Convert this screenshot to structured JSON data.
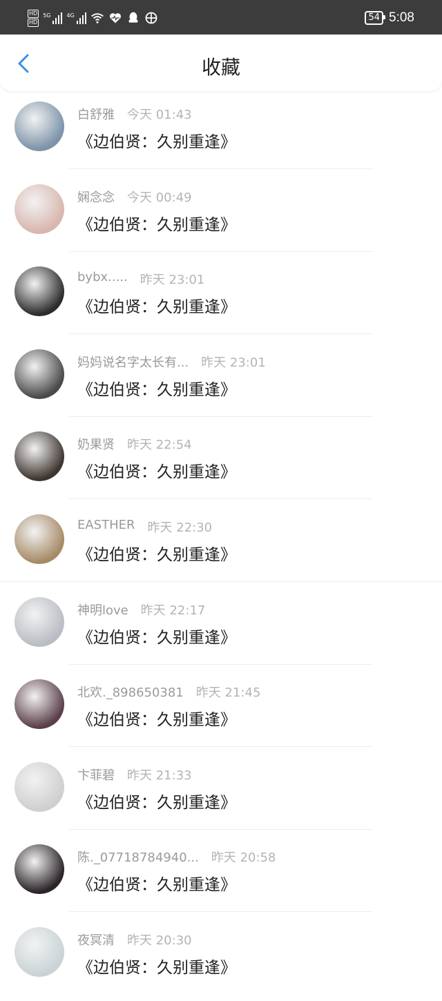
{
  "status_bar": {
    "hd1": "HD",
    "hd2": "HD",
    "sig1_label": "5G",
    "sig2_label": "4G",
    "wifi_label": "6",
    "battery": "54",
    "time": "5:08"
  },
  "header": {
    "title": "收藏"
  },
  "items": [
    {
      "name": "白舒雅",
      "time": "今天 01:43",
      "content": "《边伯贤：久别重逢》",
      "avatar_color": "#7c93a8"
    },
    {
      "name": "娴念念",
      "time": "今天 00:49",
      "content": "《边伯贤：久别重逢》",
      "avatar_color": "#d8b6ae"
    },
    {
      "name": "bybx.....",
      "time": "昨天 23:01",
      "content": "《边伯贤：久别重逢》",
      "avatar_color": "#2c2c2c"
    },
    {
      "name": "妈妈说名字太长有...",
      "time": "昨天 23:01",
      "content": "《边伯贤：久别重逢》",
      "avatar_color": "#4a4a4a"
    },
    {
      "name": "奶果贤",
      "time": "昨天 22:54",
      "content": "《边伯贤：久别重逢》",
      "avatar_color": "#3e3530"
    },
    {
      "name": "EASTHER",
      "time": "昨天 22:30",
      "content": "《边伯贤：久别重逢》",
      "avatar_color": "#a68a66"
    },
    {
      "name": "神明love",
      "time": "昨天 22:17",
      "content": "《边伯贤：久别重逢》",
      "avatar_color": "#b9bcc4"
    },
    {
      "name": "北欢._898650381",
      "time": "昨天 21:45",
      "content": "《边伯贤：久别重逢》",
      "avatar_color": "#5a3f4a"
    },
    {
      "name": "卞菲碧",
      "time": "昨天 21:33",
      "content": "《边伯贤：久别重逢》",
      "avatar_color": "#cfcfcf"
    },
    {
      "name": "陈._07718784940...",
      "time": "昨天 20:58",
      "content": "《边伯贤：久别重逢》",
      "avatar_color": "#2a2428"
    },
    {
      "name": "夜冥清",
      "time": "昨天 20:30",
      "content": "《边伯贤：久别重逢》",
      "avatar_color": "#c9d3d6"
    }
  ],
  "colors": {
    "accent": "#3a8ee6",
    "status_bar_bg": "#3c3c3c",
    "name_text": "#9a9a9a",
    "content_text": "#222222"
  }
}
